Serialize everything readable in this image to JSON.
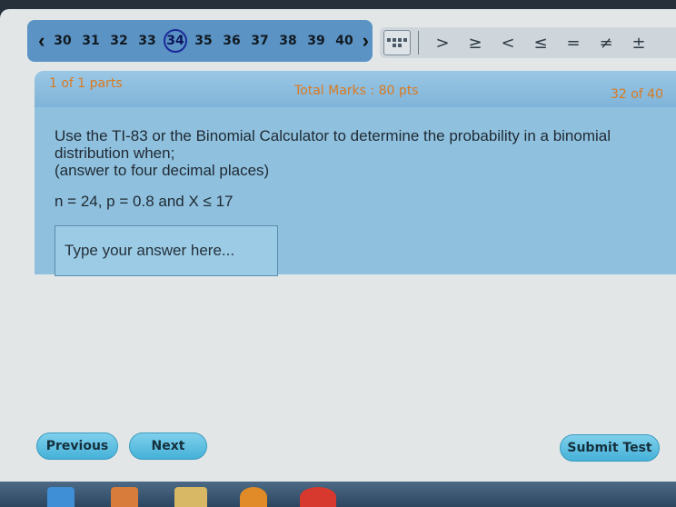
{
  "navigation": {
    "prev_arrow": "‹",
    "next_arrow": "›",
    "questions": [
      "30",
      "31",
      "32",
      "33",
      "34",
      "35",
      "36",
      "37",
      "38",
      "39",
      "40"
    ],
    "current": "34"
  },
  "symbols": [
    ">",
    "≥",
    "<",
    "≤",
    "=",
    "≠",
    "±"
  ],
  "parts_bar": {
    "parts": "1 of 1 parts",
    "total_marks": "Total Marks : 80 pts",
    "progress": "32 of 40"
  },
  "question": {
    "text_line1": "Use the TI-83 or the Binomial Calculator to determine the probability in a binomial distribution when;",
    "text_line2": "(answer to four decimal places)",
    "params": "n = 24, p = 0.8 and X ≤  17",
    "answer_placeholder": "Type your answer here..."
  },
  "buttons": {
    "previous": "Previous",
    "next": "Next",
    "submit": "Submit Test"
  }
}
